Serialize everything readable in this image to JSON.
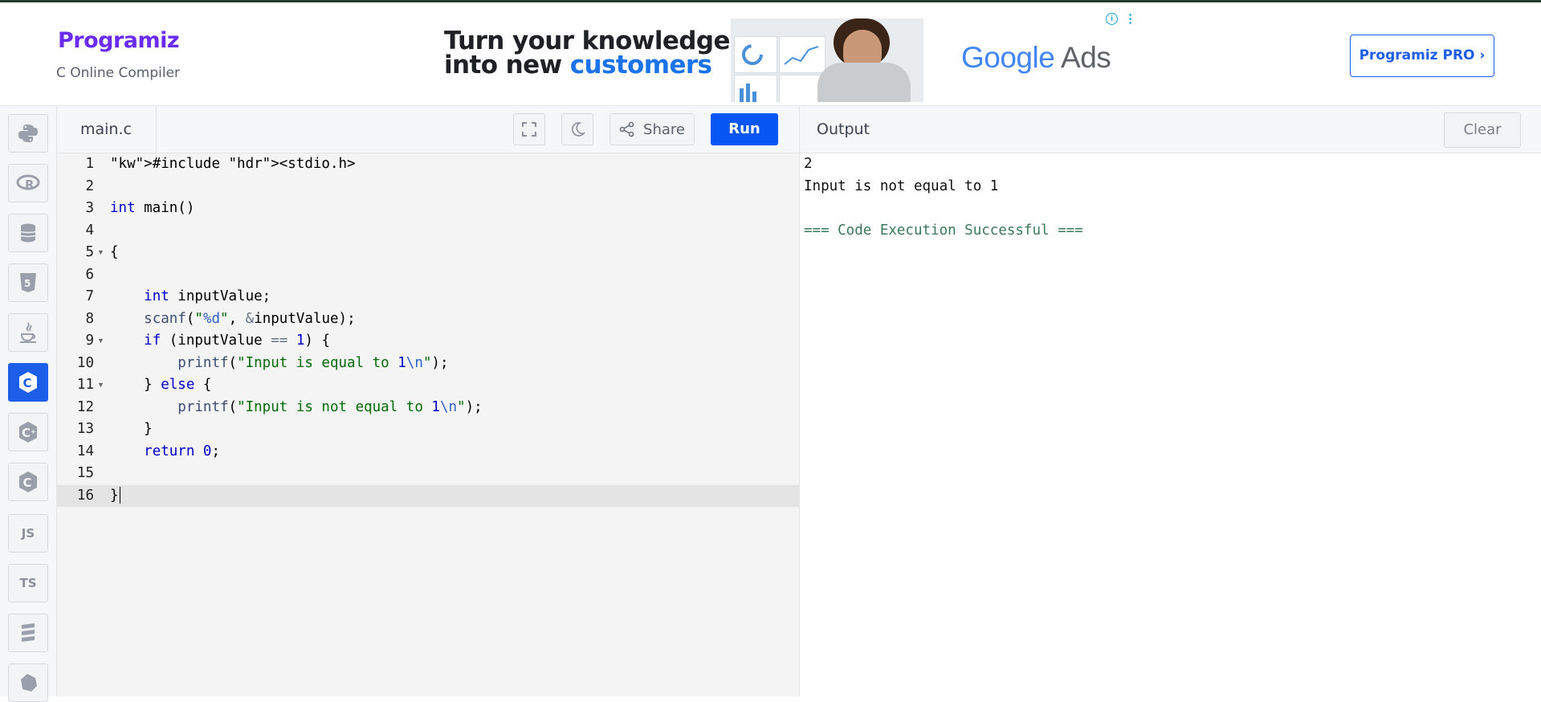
{
  "header": {
    "logo": "Programiz",
    "subtitle": "C Online Compiler",
    "pro_button": "Programiz PRO ›"
  },
  "ad": {
    "headline_line1": "Turn your knowledge",
    "headline_line2_a": "into new ",
    "headline_line2_b": "customers",
    "brand_google": "Google",
    "brand_ads": " Ads",
    "info": "i",
    "menu": "⋮"
  },
  "sidebar": {
    "items": [
      {
        "name": "python",
        "label": "",
        "active": false
      },
      {
        "name": "r",
        "label": "R",
        "active": false
      },
      {
        "name": "sql",
        "label": "",
        "active": false
      },
      {
        "name": "html",
        "label": "5",
        "active": false
      },
      {
        "name": "java",
        "label": "",
        "active": false
      },
      {
        "name": "c",
        "label": "C",
        "active": true
      },
      {
        "name": "cpp",
        "label": "C",
        "active": false
      },
      {
        "name": "csharp",
        "label": "C",
        "active": false
      },
      {
        "name": "js",
        "label": "JS",
        "active": false
      },
      {
        "name": "ts",
        "label": "TS",
        "active": false
      },
      {
        "name": "go",
        "label": "",
        "active": false
      },
      {
        "name": "swift",
        "label": "",
        "active": false
      }
    ]
  },
  "editor": {
    "file_tab": "main.c",
    "share_label": "Share",
    "run_label": "Run",
    "lines": [
      "#include <stdio.h>",
      "",
      "int main()",
      "",
      "{",
      "",
      "    int inputValue;",
      "    scanf(\"%d\", &inputValue);",
      "    if (inputValue == 1) {",
      "        printf(\"Input is equal to 1\\n\");",
      "    } else {",
      "        printf(\"Input is not equal to 1\\n\");",
      "    }",
      "    return 0;",
      "",
      "}"
    ],
    "line_numbers": [
      "1",
      "2",
      "3",
      "4",
      "5",
      "6",
      "7",
      "8",
      "9",
      "10",
      "11",
      "12",
      "13",
      "14",
      "15",
      "16"
    ],
    "fold_lines": [
      5,
      9,
      11
    ],
    "active_line": 16
  },
  "output": {
    "title": "Output",
    "clear_label": "Clear",
    "lines": [
      "2",
      "Input is not equal to 1",
      "",
      "=== Code Execution Successful ==="
    ]
  },
  "colors": {
    "accent": "#0556f3",
    "brand_purple": "#6a2cf0",
    "keyword": "#0000cc",
    "string": "#036a07",
    "success": "#3a7a5a"
  }
}
